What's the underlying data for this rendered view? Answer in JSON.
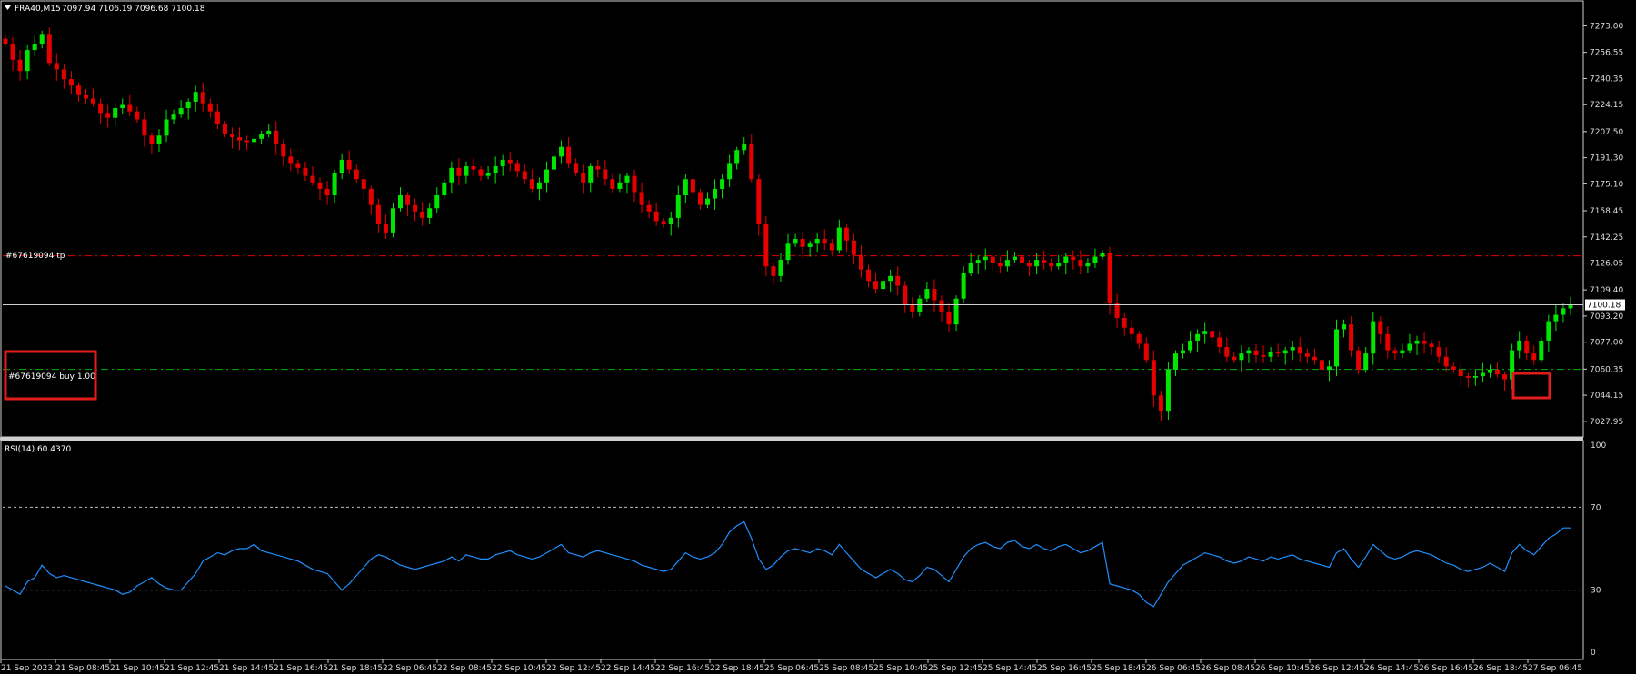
{
  "header": {
    "symbol": "FRA40,M15",
    "ohlc": "7097.94 7106.19 7096.68 7100.18",
    "menu_icon": "triangle-down-icon"
  },
  "price_axis": {
    "labels": [
      "7273.00",
      "7256.55",
      "7240.35",
      "7224.15",
      "7207.50",
      "7191.30",
      "7175.10",
      "7158.45",
      "7142.25",
      "7126.05",
      "7109.40",
      "7093.20",
      "7077.00",
      "7060.35",
      "7044.15",
      "7027.95"
    ],
    "current_price_label": "7100.18"
  },
  "order_lines": {
    "tp_label": "#67619094 tp",
    "tp_price": 7130.5,
    "buy_label": "#67619094 buy 1.00",
    "buy_price": 7060.2
  },
  "rsi": {
    "label": "RSI(14) 60.4370",
    "axis_labels": [
      "100",
      "70",
      "30",
      "0"
    ],
    "levels": [
      70,
      30
    ]
  },
  "time_axis": {
    "labels": [
      "21 Sep 2023",
      "21 Sep 08:45",
      "21 Sep 10:45",
      "21 Sep 12:45",
      "21 Sep 14:45",
      "21 Sep 16:45",
      "21 Sep 18:45",
      "22 Sep 06:45",
      "22 Sep 08:45",
      "22 Sep 10:45",
      "22 Sep 12:45",
      "22 Sep 14:45",
      "22 Sep 16:45",
      "22 Sep 18:45",
      "25 Sep 06:45",
      "25 Sep 08:45",
      "25 Sep 10:45",
      "25 Sep 12:45",
      "25 Sep 14:45",
      "25 Sep 16:45",
      "25 Sep 18:45",
      "26 Sep 06:45",
      "26 Sep 08:45",
      "26 Sep 10:45",
      "26 Sep 12:45",
      "26 Sep 14:45",
      "26 Sep 16:45",
      "26 Sep 18:45",
      "27 Sep 06:45"
    ]
  },
  "colors": {
    "background": "#000000",
    "bull": "#00e600",
    "bear": "#e60000",
    "rsi_line": "#1e90ff",
    "tp_line": "#e60000",
    "buy_line": "#00b300",
    "highlight_box": "#e21b1b"
  },
  "chart_data": {
    "type": "candlestick",
    "symbol": "FRA40",
    "timeframe": "M15",
    "ylim": [
      7020,
      7280
    ],
    "close_series": [
      7262,
      7252,
      7245,
      7258,
      7262,
      7268,
      7250,
      7246,
      7240,
      7236,
      7230,
      7228,
      7225,
      7219,
      7216,
      7222,
      7224,
      7220,
      7215,
      7205,
      7200,
      7205,
      7215,
      7218,
      7222,
      7226,
      7232,
      7225,
      7220,
      7212,
      7206,
      7204,
      7202,
      7201,
      7203,
      7206,
      7208,
      7200,
      7192,
      7188,
      7185,
      7180,
      7176,
      7172,
      7168,
      7182,
      7190,
      7184,
      7178,
      7172,
      7162,
      7150,
      7145,
      7160,
      7168,
      7162,
      7158,
      7154,
      7160,
      7168,
      7176,
      7185,
      7180,
      7186,
      7184,
      7180,
      7182,
      7186,
      7190,
      7188,
      7183,
      7178,
      7172,
      7176,
      7184,
      7192,
      7198,
      7188,
      7182,
      7176,
      7186,
      7184,
      7178,
      7172,
      7176,
      7180,
      7170,
      7162,
      7158,
      7152,
      7150,
      7154,
      7168,
      7178,
      7170,
      7162,
      7166,
      7172,
      7178,
      7188,
      7196,
      7200,
      7178,
      7150,
      7124,
      7118,
      7128,
      7138,
      7141,
      7136,
      7138,
      7141,
      7138,
      7134,
      7148,
      7140,
      7131,
      7122,
      7115,
      7110,
      7115,
      7118,
      7112,
      7100,
      7096,
      7104,
      7110,
      7103,
      7096,
      7088,
      7104,
      7120,
      7126,
      7128,
      7130,
      7126,
      7124,
      7128,
      7130,
      7126,
      7124,
      7128,
      7126,
      7124,
      7126,
      7130,
      7128,
      7124,
      7126,
      7130,
      7132,
      7101,
      7092,
      7086,
      7082,
      7076,
      7066,
      7044,
      7034,
      7060,
      7070,
      7072,
      7078,
      7082,
      7084,
      7080,
      7074,
      7068,
      7066,
      7070,
      7072,
      7069,
      7068,
      7071,
      7070,
      7072,
      7074,
      7070,
      7068,
      7066,
      7060,
      7062,
      7085,
      7088,
      7072,
      7060,
      7070,
      7090,
      7082,
      7072,
      7070,
      7072,
      7076,
      7078,
      7076,
      7074,
      7068,
      7062,
      7060,
      7056,
      7055,
      7056,
      7058,
      7060,
      7057,
      7054,
      7072,
      7078,
      7070,
      7066,
      7078,
      7090,
      7094,
      7098,
      7100
    ],
    "rsi_series": [
      32,
      30,
      28,
      34,
      36,
      42,
      38,
      36,
      37,
      36,
      35,
      34,
      33,
      32,
      31,
      30,
      28,
      29,
      32,
      34,
      36,
      33,
      31,
      30,
      30,
      34,
      38,
      44,
      46,
      48,
      47,
      49,
      50,
      50,
      52,
      49,
      48,
      47,
      46,
      45,
      44,
      42,
      40,
      39,
      38,
      34,
      30,
      33,
      37,
      41,
      45,
      47,
      46,
      44,
      42,
      41,
      40,
      41,
      42,
      43,
      44,
      46,
      44,
      47,
      46,
      45,
      45,
      47,
      48,
      49,
      47,
      46,
      45,
      46,
      48,
      50,
      52,
      48,
      47,
      46,
      48,
      49,
      48,
      47,
      46,
      45,
      44,
      42,
      41,
      40,
      39,
      40,
      44,
      48,
      46,
      45,
      46,
      48,
      52,
      58,
      61,
      63,
      55,
      45,
      40,
      42,
      46,
      49,
      50,
      49,
      48,
      50,
      49,
      47,
      52,
      48,
      44,
      40,
      38,
      36,
      38,
      40,
      38,
      35,
      34,
      37,
      41,
      40,
      37,
      34,
      40,
      46,
      50,
      52,
      53,
      51,
      50,
      53,
      54,
      51,
      50,
      52,
      50,
      49,
      51,
      52,
      50,
      48,
      49,
      51,
      53,
      33,
      32,
      31,
      30,
      28,
      24,
      22,
      28,
      34,
      38,
      42,
      44,
      46,
      48,
      47,
      46,
      44,
      43,
      44,
      46,
      45,
      44,
      46,
      45,
      46,
      47,
      45,
      44,
      43,
      42,
      41,
      48,
      50,
      45,
      41,
      46,
      52,
      49,
      46,
      45,
      46,
      48,
      49,
      48,
      47,
      45,
      43,
      42,
      40,
      39,
      40,
      41,
      43,
      41,
      39,
      48,
      52,
      49,
      47,
      51,
      55,
      57,
      60,
      60
    ]
  }
}
